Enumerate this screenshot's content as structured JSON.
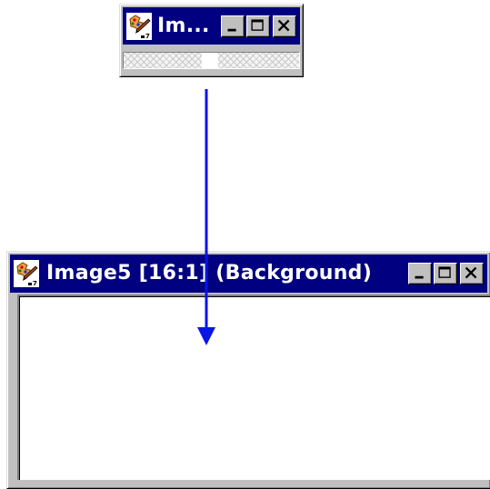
{
  "small_window": {
    "title": "Im...",
    "icon": "paint-palette-icon",
    "buttons": {
      "minimize": "minimize-icon",
      "maximize": "maximize-icon",
      "close": "close-icon"
    }
  },
  "large_window": {
    "title": "Image5 [16:1] (Background)",
    "icon": "paint-palette-icon",
    "buttons": {
      "minimize": "minimize-icon",
      "maximize": "maximize-icon",
      "close": "close-icon"
    }
  },
  "arrow": {
    "direction": "down",
    "color": "#0a14e6"
  },
  "colors": {
    "titlebar": "#000080",
    "face": "#c0c0c0"
  }
}
